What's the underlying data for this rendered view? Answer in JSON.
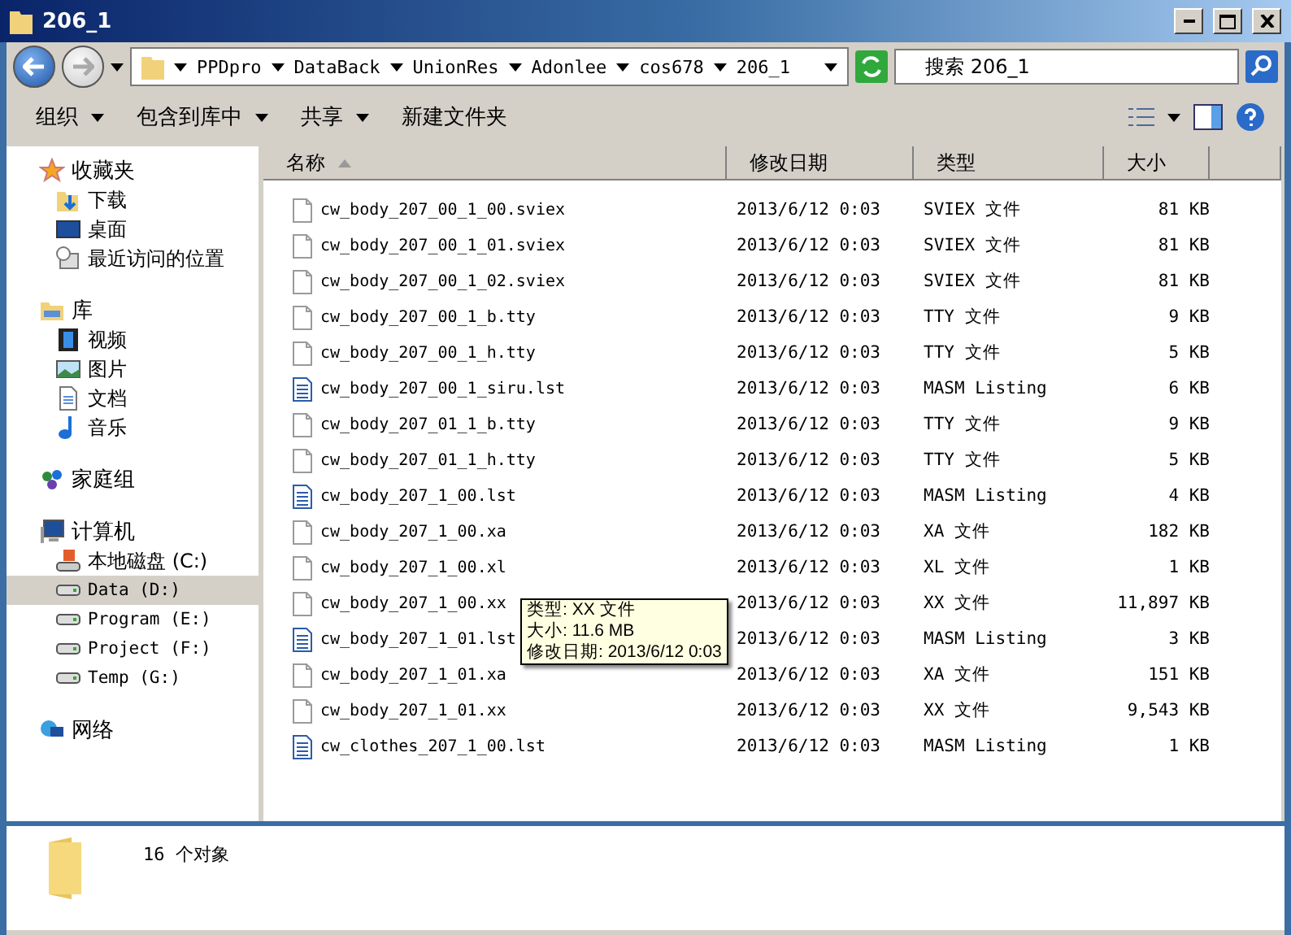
{
  "window": {
    "title": "206_1"
  },
  "address": {
    "segments": [
      "PPDpro",
      "DataBack",
      "UnionRes",
      "Adonlee",
      "cos678",
      "206_1"
    ]
  },
  "search": {
    "value": "搜索 206_1"
  },
  "toolbar": {
    "buttons": [
      {
        "label": "组织",
        "dropdown": true
      },
      {
        "label": "包含到库中",
        "dropdown": true
      },
      {
        "label": "共享",
        "dropdown": true
      },
      {
        "label": "新建文件夹",
        "dropdown": false
      }
    ]
  },
  "sidebar": {
    "groups": [
      {
        "label": "收藏夹",
        "items": [
          {
            "label": "下载",
            "selected": false
          },
          {
            "label": "桌面",
            "selected": false
          },
          {
            "label": "最近访问的位置",
            "selected": false
          }
        ]
      },
      {
        "label": "库",
        "items": [
          {
            "label": "视频",
            "selected": false
          },
          {
            "label": "图片",
            "selected": false
          },
          {
            "label": "文档",
            "selected": false
          },
          {
            "label": "音乐",
            "selected": false
          }
        ]
      },
      {
        "label": "家庭组"
      },
      {
        "label": "计算机",
        "items": [
          {
            "label": "本地磁盘 (C:)",
            "selected": false
          },
          {
            "label": "Data (D:)",
            "selected": true
          },
          {
            "label": "Program (E:)",
            "selected": false
          },
          {
            "label": "Project (F:)",
            "selected": false
          },
          {
            "label": "Temp (G:)",
            "selected": false
          }
        ]
      },
      {
        "label": "网络"
      }
    ]
  },
  "table": {
    "columns": [
      {
        "label": "名称",
        "sorted": true
      },
      {
        "label": "修改日期",
        "sorted": false
      },
      {
        "label": "类型",
        "sorted": false
      },
      {
        "label": "大小",
        "sorted": false
      }
    ],
    "rows": [
      {
        "kind": "file",
        "name": "cw_body_207_00_1_00.sviex",
        "date": "2013/6/12 0:03",
        "type": "SVIEX 文件",
        "size": "81 KB"
      },
      {
        "kind": "file",
        "name": "cw_body_207_00_1_01.sviex",
        "date": "2013/6/12 0:03",
        "type": "SVIEX 文件",
        "size": "81 KB"
      },
      {
        "kind": "file",
        "name": "cw_body_207_00_1_02.sviex",
        "date": "2013/6/12 0:03",
        "type": "SVIEX 文件",
        "size": "81 KB"
      },
      {
        "kind": "file",
        "name": "cw_body_207_00_1_b.tty",
        "date": "2013/6/12 0:03",
        "type": "TTY 文件",
        "size": "9 KB"
      },
      {
        "kind": "file",
        "name": "cw_body_207_00_1_h.tty",
        "date": "2013/6/12 0:03",
        "type": "TTY 文件",
        "size": "5 KB"
      },
      {
        "kind": "text",
        "name": "cw_body_207_00_1_siru.lst",
        "date": "2013/6/12 0:03",
        "type": "MASM Listing",
        "size": "6 KB"
      },
      {
        "kind": "file",
        "name": "cw_body_207_01_1_b.tty",
        "date": "2013/6/12 0:03",
        "type": "TTY 文件",
        "size": "9 KB"
      },
      {
        "kind": "file",
        "name": "cw_body_207_01_1_h.tty",
        "date": "2013/6/12 0:03",
        "type": "TTY 文件",
        "size": "5 KB"
      },
      {
        "kind": "text",
        "name": "cw_body_207_1_00.lst",
        "date": "2013/6/12 0:03",
        "type": "MASM Listing",
        "size": "4 KB"
      },
      {
        "kind": "file",
        "name": "cw_body_207_1_00.xa",
        "date": "2013/6/12 0:03",
        "type": "XA 文件",
        "size": "182 KB"
      },
      {
        "kind": "file",
        "name": "cw_body_207_1_00.xl",
        "date": "2013/6/12 0:03",
        "type": "XL 文件",
        "size": "1 KB"
      },
      {
        "kind": "file",
        "name": "cw_body_207_1_00.xx",
        "date": "2013/6/12 0:03",
        "type": "XX 文件",
        "size": "11,897 KB"
      },
      {
        "kind": "text",
        "name": "cw_body_207_1_01.lst",
        "date": "2013/6/12 0:03",
        "type": "MASM Listing",
        "size": "3 KB"
      },
      {
        "kind": "file",
        "name": "cw_body_207_1_01.xa",
        "date": "2013/6/12 0:03",
        "type": "XA 文件",
        "size": "151 KB"
      },
      {
        "kind": "file",
        "name": "cw_body_207_1_01.xx",
        "date": "2013/6/12 0:03",
        "type": "XX 文件",
        "size": "9,543 KB"
      },
      {
        "kind": "text",
        "name": "cw_clothes_207_1_00.lst",
        "date": "2013/6/12 0:03",
        "type": "MASM Listing",
        "size": "1 KB"
      }
    ]
  },
  "tooltip": {
    "lines": [
      "类型: XX 文件",
      "大小: 11.6 MB",
      "修改日期: 2013/6/12 0:03"
    ]
  },
  "status_bar": {
    "count": "16 个对象"
  }
}
